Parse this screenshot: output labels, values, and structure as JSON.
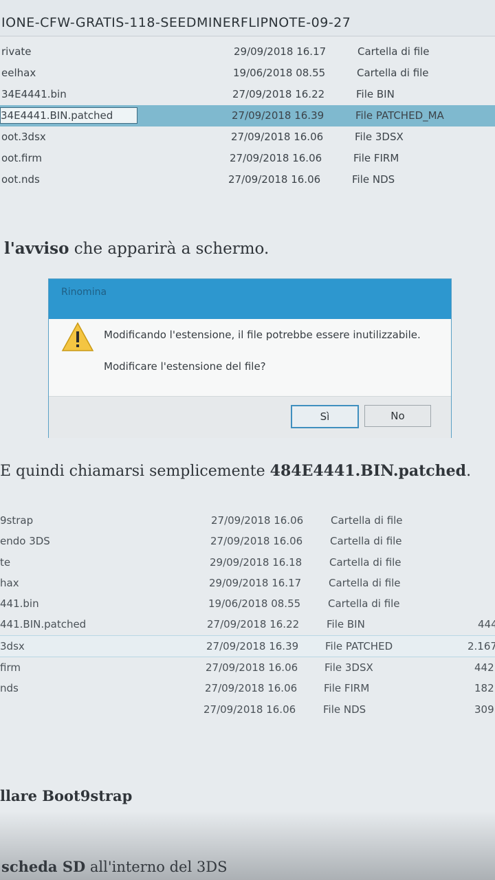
{
  "window": {
    "path_title": "IONE-CFW-GRATIS-118-SEEDMINERFLIPNOTE-09-27"
  },
  "files_top": [
    {
      "name": "rivate",
      "date": "29/09/2018 16.17",
      "type": "Cartella di file"
    },
    {
      "name": "eelhax",
      "date": "19/06/2018 08.55",
      "type": "Cartella di file"
    },
    {
      "name": "34E4441.bin",
      "date": "27/09/2018 16.22",
      "type": "File BIN"
    },
    {
      "name": "34E4441.BIN.patched",
      "date": "27/09/2018 16.39",
      "type": "File PATCHED_MA"
    },
    {
      "name": "oot.3dsx",
      "date": "27/09/2018 16.06",
      "type": "File 3DSX"
    },
    {
      "name": "oot.firm",
      "date": "27/09/2018 16.06",
      "type": "File FIRM"
    },
    {
      "name": "oot.nds",
      "date": "27/09/2018 16.06",
      "type": "File NDS"
    }
  ],
  "article": {
    "line1_bold": "l'avviso",
    "line1_rest": " che apparirà a schermo.",
    "line2_pre": "E quindi chiamarsi semplicemente ",
    "line2_bold": "484E4441.BIN.patched",
    "line2_post": ".",
    "heading": "llare Boot9strap",
    "footer_bold": "scheda SD",
    "footer_rest": " all'interno del 3DS"
  },
  "dialog": {
    "title": "Rinomina",
    "message": "Modificando l'estensione, il file potrebbe essere inutilizzabile.",
    "question": "Modificare l'estensione del file?",
    "yes_label": "Sì",
    "no_label": "No",
    "accent_color": "#2d97cf"
  },
  "files_bottom": [
    {
      "name": "9strap",
      "date": "27/09/2018 16.06",
      "type": "Cartella di file",
      "size": ""
    },
    {
      "name": "endo 3DS",
      "date": "27/09/2018 16.06",
      "type": "Cartella di file",
      "size": ""
    },
    {
      "name": "te",
      "date": "29/09/2018 16.18",
      "type": "Cartella di file",
      "size": ""
    },
    {
      "name": "hax",
      "date": "29/09/2018 16.17",
      "type": "Cartella di file",
      "size": ""
    },
    {
      "name": "441.bin",
      "date": "19/06/2018 08.55",
      "type": "Cartella di file",
      "size": ""
    },
    {
      "name": "441.BIN.patched",
      "date": "27/09/2018 16.22",
      "type": "File BIN",
      "size": "444"
    },
    {
      "name": "3dsx",
      "date": "27/09/2018 16.39",
      "type": "File PATCHED",
      "size": "2.167"
    },
    {
      "name": "firm",
      "date": "27/09/2018 16.06",
      "type": "File 3DSX",
      "size": "442"
    },
    {
      "name": "nds",
      "date": "27/09/2018 16.06",
      "type": "File FIRM",
      "size": "182"
    },
    {
      "name": "",
      "date": "27/09/2018 16.06",
      "type": "File NDS",
      "size": "309"
    }
  ]
}
